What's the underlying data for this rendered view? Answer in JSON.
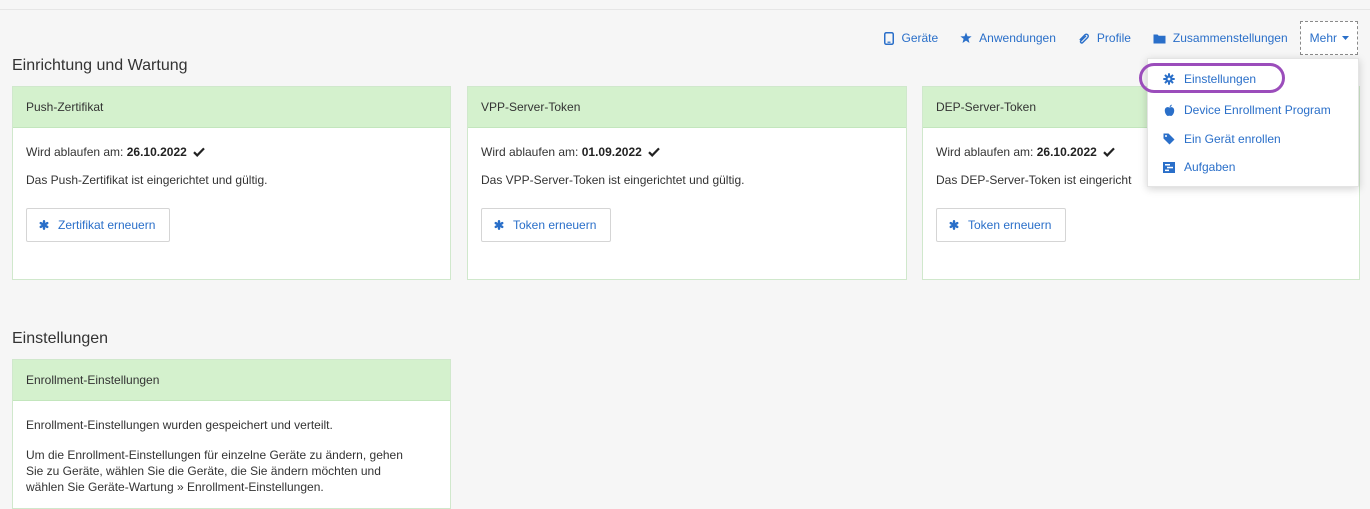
{
  "nav": {
    "geraete": "Geräte",
    "anwendungen": "Anwendungen",
    "profile": "Profile",
    "zusammenstellungen": "Zusammenstellungen",
    "mehr": "Mehr"
  },
  "sections": {
    "einrichtung": "Einrichtung und Wartung",
    "einstellungen": "Einstellungen"
  },
  "cards": [
    {
      "title": "Push-Zertifikat",
      "expires_label": "Wird ablaufen am:",
      "expires_date": "26.10.2022",
      "status": "Das Push-Zertifikat ist eingerichtet und gültig.",
      "button": "Zertifikat erneuern"
    },
    {
      "title": "VPP-Server-Token",
      "expires_label": "Wird ablaufen am:",
      "expires_date": "01.09.2022",
      "status": "Das VPP-Server-Token ist eingerichtet und gültig.",
      "button": "Token erneuern"
    },
    {
      "title": "DEP-Server-Token",
      "expires_label": "Wird ablaufen am:",
      "expires_date": "26.10.2022",
      "status": "Das DEP-Server-Token ist eingericht",
      "button": "Token erneuern"
    }
  ],
  "enrollment": {
    "title": "Enrollment-Einstellungen",
    "line1": "Enrollment-Einstellungen wurden gespeichert und verteilt.",
    "line2a": "Um die Enrollment-Einstellungen für einzelne Geräte zu ändern, gehen",
    "line2b": "Sie zu Geräte, wählen Sie die Geräte, die Sie ändern möchten und",
    "line2c": "wählen Sie Geräte-Wartung » Enrollment-Einstellungen."
  },
  "dropdown": {
    "items": [
      "Einstellungen",
      "Device Enrollment Program",
      "Ein Gerät enrollen",
      "Aufgaben"
    ]
  },
  "colors": {
    "link": "#2a6fc9",
    "card_header": "#d4f1cd",
    "highlight": "#9b4dbb"
  },
  "icons": {
    "geraete": "tablet-icon",
    "anwendungen": "star-icon",
    "profile": "paperclip-icon",
    "zusammenstellungen": "folder-icon",
    "mehr": "caret-down-icon",
    "einstellungen": "gear-icon",
    "dep": "apple-icon",
    "enroll": "tag-icon",
    "aufgaben": "tasks-icon",
    "renew": "asterisk-icon",
    "valid": "checkmark-icon"
  }
}
